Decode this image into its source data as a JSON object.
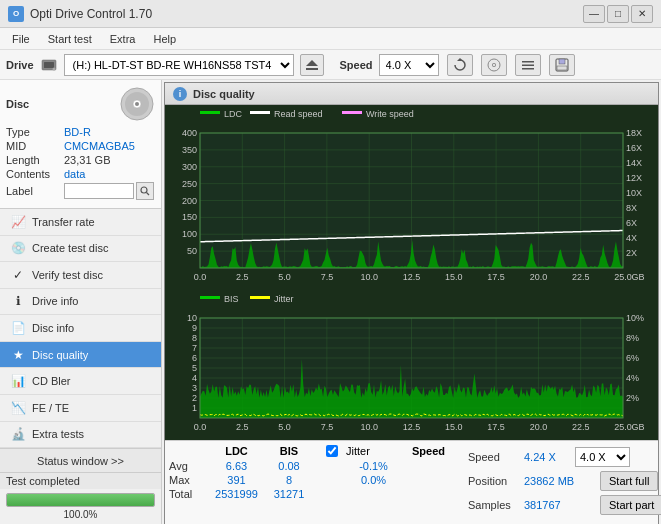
{
  "app": {
    "title": "Opti Drive Control 1.70",
    "icon": "O"
  },
  "titlebar": {
    "minimize": "—",
    "maximize": "□",
    "close": "✕"
  },
  "menu": {
    "items": [
      "File",
      "Start test",
      "Extra",
      "Help"
    ]
  },
  "drive_bar": {
    "label": "Drive",
    "drive_value": "(H:) HL-DT-ST BD-RE  WH16NS58 TST4",
    "speed_label": "Speed",
    "speed_value": "4.0 X"
  },
  "disc": {
    "title": "Disc",
    "type_label": "Type",
    "type_value": "BD-R",
    "mid_label": "MID",
    "mid_value": "CMCMAGBA5",
    "length_label": "Length",
    "length_value": "23,31 GB",
    "contents_label": "Contents",
    "contents_value": "data",
    "label_label": "Label"
  },
  "nav": {
    "items": [
      {
        "id": "transfer-rate",
        "label": "Transfer rate",
        "icon": "📈"
      },
      {
        "id": "create-test-disc",
        "label": "Create test disc",
        "icon": "💿"
      },
      {
        "id": "verify-test-disc",
        "label": "Verify test disc",
        "icon": "✓"
      },
      {
        "id": "drive-info",
        "label": "Drive info",
        "icon": "ℹ"
      },
      {
        "id": "disc-info",
        "label": "Disc info",
        "icon": "📄"
      },
      {
        "id": "disc-quality",
        "label": "Disc quality",
        "icon": "★",
        "active": true
      },
      {
        "id": "cd-bler",
        "label": "CD Bler",
        "icon": "📊"
      },
      {
        "id": "fe-te",
        "label": "FE / TE",
        "icon": "📉"
      },
      {
        "id": "extra-tests",
        "label": "Extra tests",
        "icon": "🔬"
      }
    ]
  },
  "status": {
    "window_btn": "Status window >>",
    "progress": 100.0,
    "progress_text": "100.0%",
    "status_text": "Test completed"
  },
  "disc_quality": {
    "title": "Disc quality",
    "legend_upper": [
      "LDC",
      "Read speed",
      "Write speed"
    ],
    "legend_lower": [
      "BIS",
      "Jitter"
    ],
    "x_max": 25.0,
    "y_upper_max": 400,
    "y_lower_max": 10,
    "y_right_upper_max": 18,
    "y_right_lower_max": 10
  },
  "stats": {
    "headers": [
      "LDC",
      "BIS",
      "",
      "Jitter",
      "Speed",
      ""
    ],
    "avg_label": "Avg",
    "avg_ldc": "6.63",
    "avg_bis": "0.08",
    "avg_jitter": "-0.1%",
    "max_label": "Max",
    "max_ldc": "391",
    "max_bis": "8",
    "max_jitter": "0.0%",
    "total_label": "Total",
    "total_ldc": "2531999",
    "total_bis": "31271",
    "speed_label": "Speed",
    "speed_value": "4.24 X",
    "speed_dropdown": "4.0 X",
    "position_label": "Position",
    "position_value": "23862 MB",
    "samples_label": "Samples",
    "samples_value": "381767",
    "start_full": "Start full",
    "start_part": "Start part"
  },
  "colors": {
    "ldc_line": "#00aa00",
    "bis_line": "#00cc00",
    "read_speed": "#ffffff",
    "jitter_line": "#ffff00",
    "bg_chart": "#1a3a1a",
    "grid": "#2a5a2a",
    "accent_blue": "#0066cc"
  }
}
